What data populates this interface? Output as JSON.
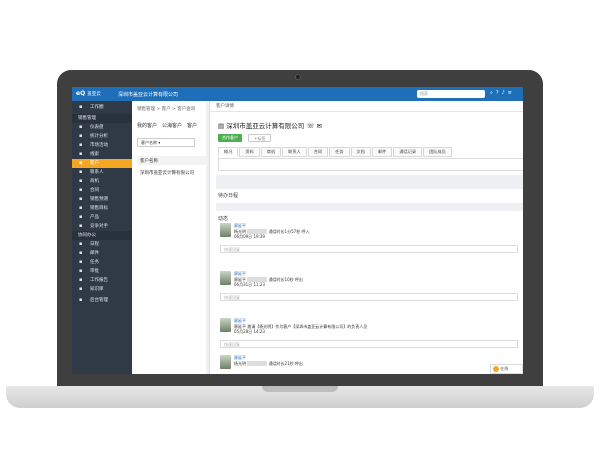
{
  "topbar": {
    "logo": "eQ",
    "logo_sub": "盖亚云",
    "company": "深圳市盖亚云计算有限公司",
    "search_placeholder": "搜索"
  },
  "sidebar": {
    "items": [
      {
        "label": "工作圈",
        "type": "big"
      },
      {
        "label": "销售管理",
        "type": "group"
      },
      {
        "label": "仪表盘"
      },
      {
        "label": "统计分析"
      },
      {
        "label": "市场活动"
      },
      {
        "label": "线索"
      },
      {
        "label": "客户",
        "active": true
      },
      {
        "label": "联系人"
      },
      {
        "label": "商机"
      },
      {
        "label": "合同"
      },
      {
        "label": "销售预测"
      },
      {
        "label": "销售目标"
      },
      {
        "label": "产品"
      },
      {
        "label": "竞争对手"
      },
      {
        "label": "协同办公",
        "type": "group"
      },
      {
        "label": "日程"
      },
      {
        "label": "邮件"
      },
      {
        "label": "任务"
      },
      {
        "label": "审批"
      },
      {
        "label": "工作报告"
      },
      {
        "label": "知识库"
      },
      {
        "label": "后台管理",
        "type": "big"
      }
    ]
  },
  "list": {
    "breadcrumb": "销售管理 > 客户 > 客户查询",
    "tabs": [
      "我的客户",
      "公海客户",
      "客户"
    ],
    "select": "客户名称",
    "column": "客户名称",
    "row": "深圳市盖亚云计算有限公司"
  },
  "detail": {
    "header": "客户详情",
    "title": "深圳市盖亚云计算有限公司",
    "btn_primary": "合作客户",
    "btn_secondary": "+标签",
    "tabs": [
      "概况",
      "资料",
      "商机",
      "联系人",
      "合同",
      "任务",
      "文档",
      "邮件",
      "通话记录",
      "团队成员"
    ],
    "todo_title": "待办日程",
    "feed_title": "动态",
    "reply_placeholder": "快速回复",
    "feed": [
      {
        "name": "廖延平",
        "line": "杨光明",
        "text": "通话时长1分57秒  呼入",
        "time": "06月09日 19:39"
      },
      {
        "name": "廖延平",
        "line": "廖延平",
        "text": "通话时长10秒  呼出",
        "time": "06月31日 11:23"
      },
      {
        "name": "廖延平",
        "line": "廖延平 邀请【杨光明】作为客户【深圳市盖亚云计算有限公司】的负责人员",
        "text": "",
        "time": "05月28日 14:23"
      },
      {
        "name": "廖延平",
        "line": "杨光明",
        "text": "通话时长21秒  呼出",
        "time": ""
      }
    ]
  },
  "chat": {
    "label": "在线"
  }
}
